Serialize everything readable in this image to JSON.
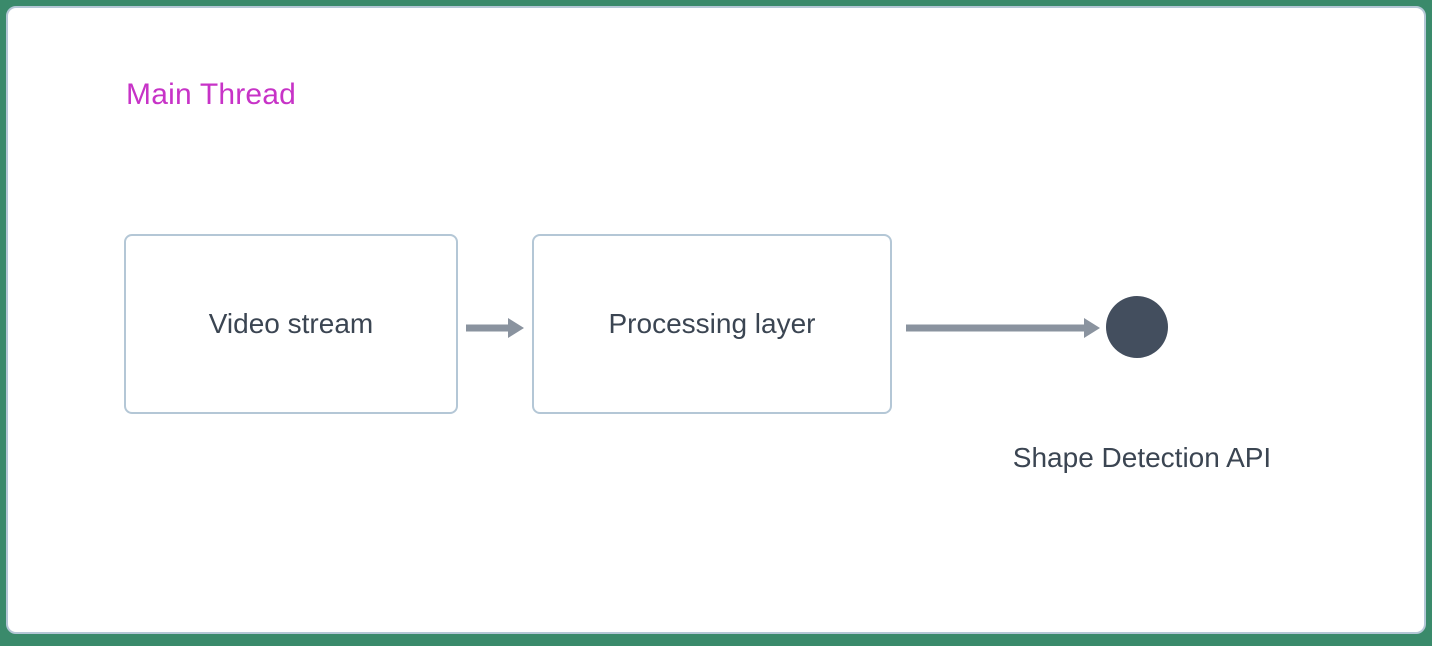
{
  "diagram": {
    "title": "Main Thread",
    "nodes": {
      "video": "Video stream",
      "processing": "Processing layer",
      "api": "Shape Detection API"
    },
    "colors": {
      "title": "#c733c7",
      "border": "#b4c7d6",
      "text": "#3b4552",
      "arrow": "#8a939f",
      "circle": "#434e5e"
    }
  }
}
